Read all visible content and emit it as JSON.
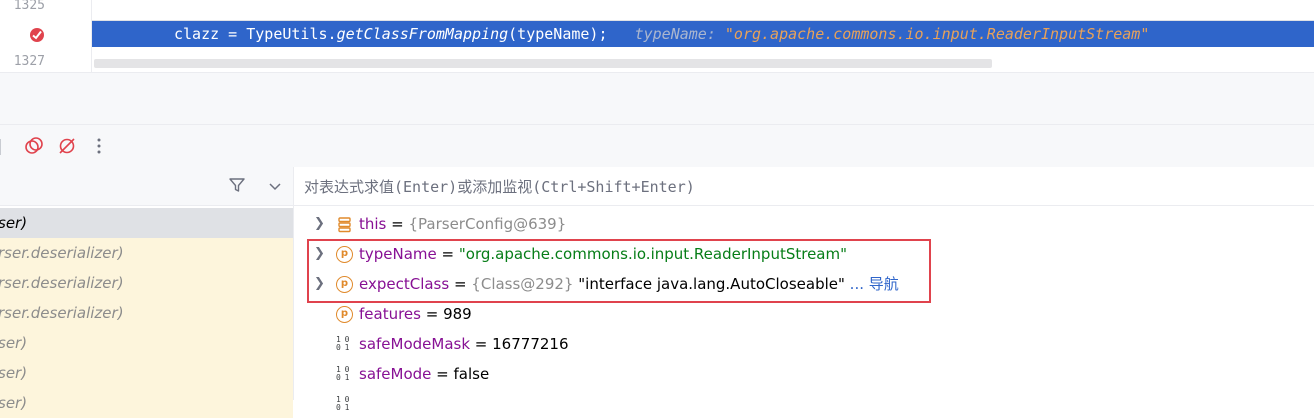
{
  "editor": {
    "line_numbers": [
      "1325",
      "",
      "1327"
    ],
    "current_line": {
      "code_prefix": "clazz = TypeUtils.",
      "code_method": "getClassFromMapping",
      "code_suffix": "(typeName);",
      "inline_name": "typeName:",
      "inline_value": "\"org.apache.commons.io.input.ReaderInputStream\""
    }
  },
  "toolbar": {
    "icons": [
      "breakpoints-icon",
      "mute-breakpoints-icon",
      "more-icon"
    ]
  },
  "frames": {
    "items": [
      {
        "label": "ser)",
        "selected": true
      },
      {
        "label": "rser.deserializer)",
        "library": true
      },
      {
        "label": "rser.deserializer)",
        "library": true
      },
      {
        "label": "rser.deserializer)",
        "library": true
      },
      {
        "label": "ser)",
        "library": true
      },
      {
        "label": "ser)",
        "library": true
      },
      {
        "label": "ser)",
        "library": true
      }
    ]
  },
  "evaluate": {
    "placeholder": "对表达式求值(Enter)或添加监视(Ctrl+Shift+Enter)"
  },
  "variables": [
    {
      "name": "this",
      "ref": "{ParserConfig@639}",
      "value": "",
      "icon": "field-list-icon",
      "expandable": true
    },
    {
      "name": "typeName",
      "ref": "",
      "value": "\"org.apache.commons.io.input.ReaderInputStream\"",
      "icon": "parameter-icon",
      "expandable": true,
      "string": true
    },
    {
      "name": "expectClass",
      "ref": "{Class@292}",
      "value": "\"interface java.lang.AutoCloseable\"",
      "nav": "... 导航",
      "icon": "parameter-icon",
      "expandable": true
    },
    {
      "name": "features",
      "ref": "",
      "value": "989",
      "icon": "parameter-icon",
      "expandable": false
    },
    {
      "name": "safeModeMask",
      "ref": "",
      "value": "16777216",
      "icon": "binary-icon",
      "expandable": false
    },
    {
      "name": "safeMode",
      "ref": "",
      "value": "false",
      "icon": "binary-icon",
      "expandable": false
    }
  ],
  "colors": {
    "execution_line": "#2f65ca",
    "highlight_box": "#e0434d"
  }
}
